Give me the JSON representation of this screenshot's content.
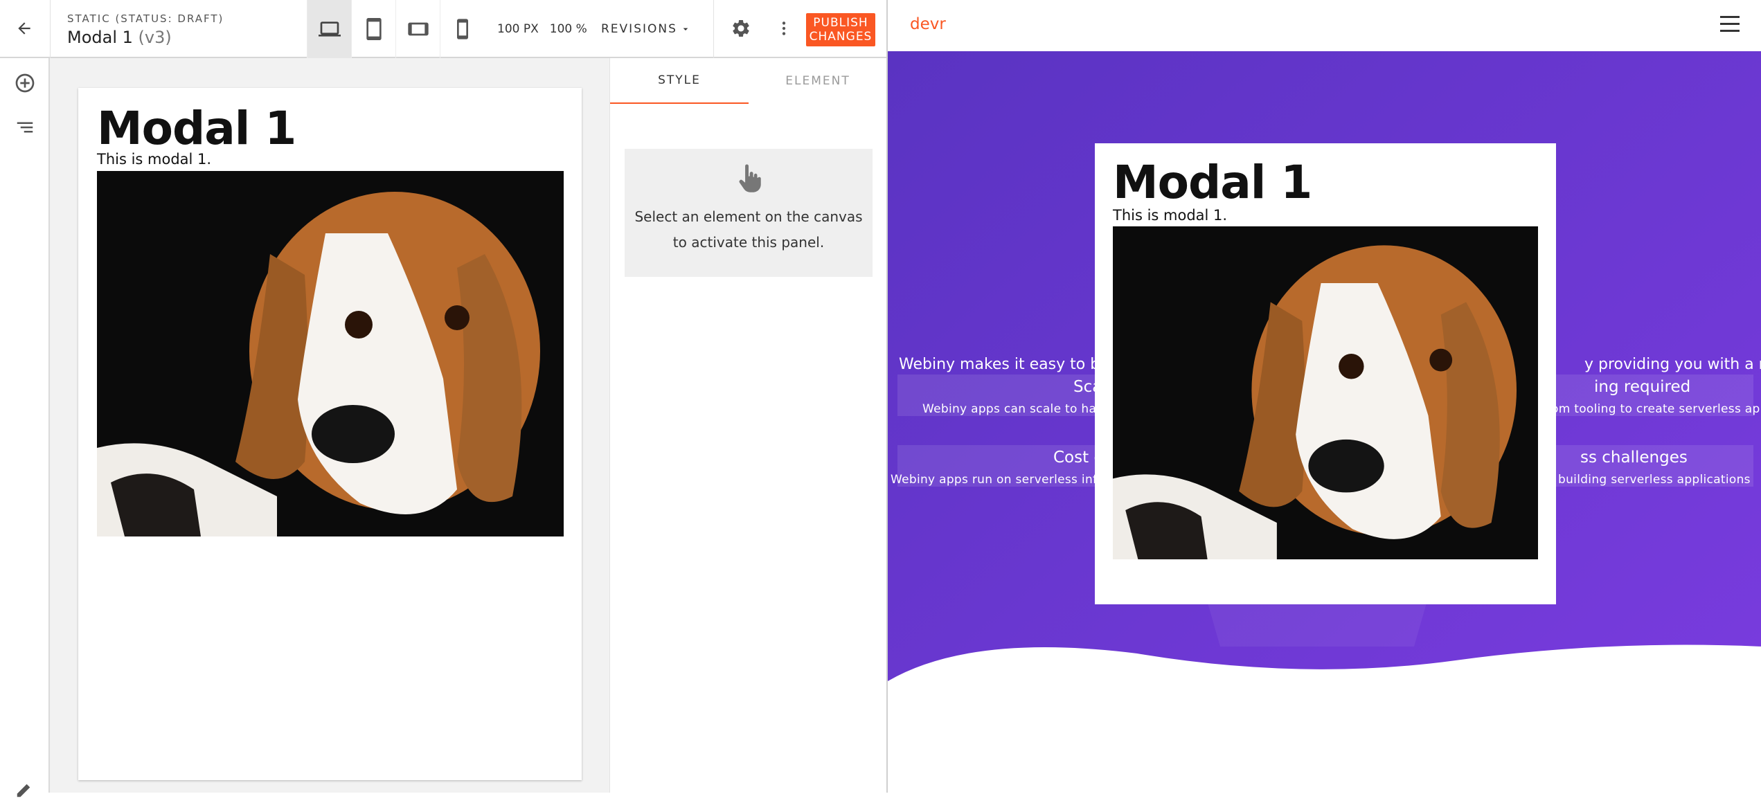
{
  "topbar": {
    "status": "STATIC (STATUS: DRAFT)",
    "page_name": "Modal 1",
    "version": "(v3)",
    "zoom_px": "100 PX",
    "zoom_pct": "100 %",
    "revisions_label": "REVISIONS",
    "publish_label": "PUBLISH CHANGES",
    "device_active": "desktop"
  },
  "canvas": {
    "heading": "Modal 1",
    "text": "This is modal 1.",
    "image": "beagle dog photo"
  },
  "panel": {
    "tabs": [
      "STYLE",
      "ELEMENT"
    ],
    "active_tab": "STYLE",
    "empty_message": "Select an element on the canvas to activate this panel."
  },
  "preview": {
    "logo": "devr",
    "hero_text_left": "Webiny makes it easy to buil",
    "hero_text_right": "y providing you with a ready-",
    "features": [
      {
        "title": "Sca",
        "desc": "Webiny apps can scale to hand"
      },
      {
        "title": "ing required",
        "desc": "om tooling to create serverless app"
      },
      {
        "title": "Cost e",
        "desc": "Webiny apps run on serverless infras"
      },
      {
        "title": "ss challenges",
        "desc": "building serverless applications"
      }
    ],
    "modal": {
      "heading": "Modal 1",
      "text": "This is modal 1."
    }
  },
  "colors": {
    "accent": "#fa5723",
    "hero_purple": "#6b3ad6"
  }
}
